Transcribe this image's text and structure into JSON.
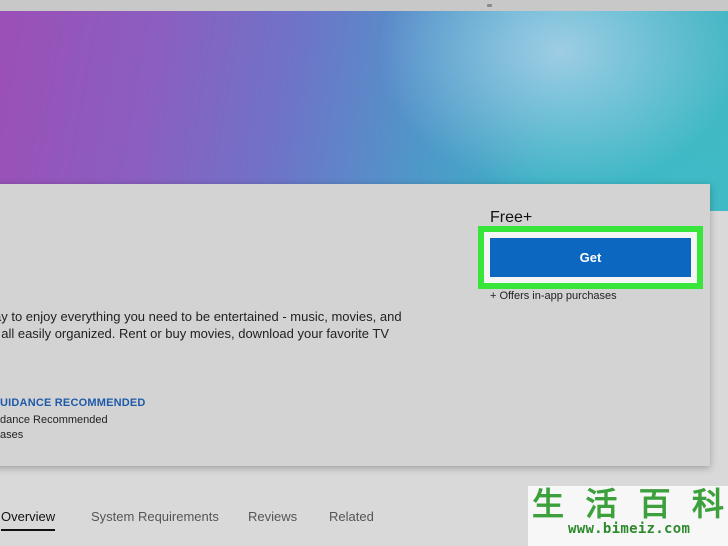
{
  "listing": {
    "price": "Free+",
    "get_label": "Get",
    "in_app_note": "+ Offers in-app purchases",
    "description_lines": [
      "ay to enjoy everything you need to be entertained - music, movies, and",
      "t all easily organized. Rent or buy movies, download your favorite TV"
    ],
    "rating_heading": "UIDANCE RECOMMENDED",
    "rating_lines": [
      "dance Recommended",
      "ases"
    ]
  },
  "tabs": [
    {
      "label": "Overview"
    },
    {
      "label": "System Requirements"
    },
    {
      "label": "Reviews"
    },
    {
      "label": "Related"
    }
  ],
  "watermark": {
    "glyphs": [
      "生",
      "活",
      "百",
      "科"
    ],
    "url": "www.bimeiz.com"
  },
  "colors": {
    "accent": "#0b67bf",
    "highlight": "#37e53b",
    "rating_heading": "#1e5aa8"
  }
}
